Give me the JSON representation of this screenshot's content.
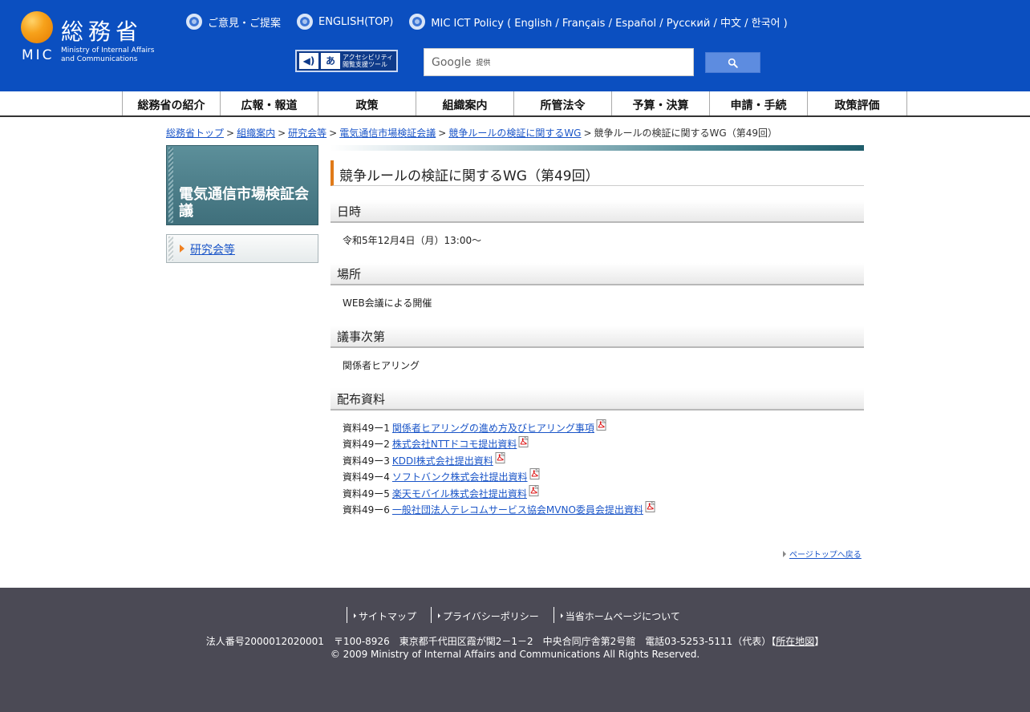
{
  "header": {
    "logo": {
      "kanji": "総務省",
      "mic": "MIC",
      "english_line1": "Ministry of Internal Affairs",
      "english_line2": "and Communications"
    },
    "lang_links": [
      {
        "label": "ご意見・ご提案"
      },
      {
        "label": "ENGLISH(TOP)"
      },
      {
        "label": "MIC ICT Policy ( English / Français / Español / Русский / 中文 / 한국어 )"
      }
    ],
    "accessibility_tool": {
      "line1": "アクセシビリティ",
      "line2": "閲覧支援ツール"
    },
    "search": {
      "brand": "Google",
      "provided": "提供"
    }
  },
  "global_nav": [
    {
      "label": "総務省の紹介"
    },
    {
      "label": "広報・報道"
    },
    {
      "label": "政策"
    },
    {
      "label": "組織案内"
    },
    {
      "label": "所管法令"
    },
    {
      "label": "予算・決算"
    },
    {
      "label": "申請・手続"
    },
    {
      "label": "政策評価"
    }
  ],
  "breadcrumb": {
    "items": [
      {
        "label": "総務省トップ"
      },
      {
        "label": "組織案内"
      },
      {
        "label": "研究会等"
      },
      {
        "label": "電気通信市場検証会議"
      },
      {
        "label": "競争ルールの検証に関するWG"
      }
    ],
    "current": "競争ルールの検証に関するWG（第49回）",
    "separator": ">"
  },
  "side": {
    "title": "電気通信市場検証会議",
    "menu_item": "研究会等"
  },
  "main": {
    "title": "競争ルールの検証に関するWG（第49回）",
    "sections": {
      "datetime": {
        "heading": "日時",
        "body": "令和5年12月4日（月）13:00～"
      },
      "place": {
        "heading": "場所",
        "body": "WEB会議による開催"
      },
      "agenda": {
        "heading": "議事次第",
        "body": "関係者ヒアリング"
      },
      "materials": {
        "heading": "配布資料"
      }
    },
    "documents": [
      {
        "no": "資料49ー1",
        "title": "関係者ヒアリングの進め方及びヒアリング事項"
      },
      {
        "no": "資料49ー2",
        "title": "株式会社NTTドコモ提出資料"
      },
      {
        "no": "資料49ー3",
        "title": "KDDI株式会社提出資料"
      },
      {
        "no": "資料49ー4",
        "title": "ソフトバンク株式会社提出資料"
      },
      {
        "no": "資料49ー5",
        "title": "楽天モバイル株式会社提出資料"
      },
      {
        "no": "資料49ー6",
        "title": "一般社団法人テレコムサービス協会MVNO委員会提出資料"
      }
    ],
    "page_top": "ページトップへ戻る"
  },
  "footer": {
    "links": [
      {
        "label": "サイトマップ"
      },
      {
        "label": "プライバシーポリシー"
      },
      {
        "label": "当省ホームページについて"
      }
    ],
    "address": "法人番号2000012020001　〒100-8926　東京都千代田区霞が関2－1－2　中央合同庁舎第2号館　電話03-5253-5111（代表）",
    "map_bracket_open": "【",
    "map_link": "所在地図",
    "map_bracket_close": "】",
    "copyright": "© 2009 Ministry of Internal Affairs and Communications All Rights Reserved."
  },
  "colors": {
    "header_bg": "#0b4fc0",
    "accent_orange": "#e07a18",
    "side_teal": "#4a7d89",
    "link": "#1a55c8",
    "footer_bg": "#4b4a55"
  }
}
